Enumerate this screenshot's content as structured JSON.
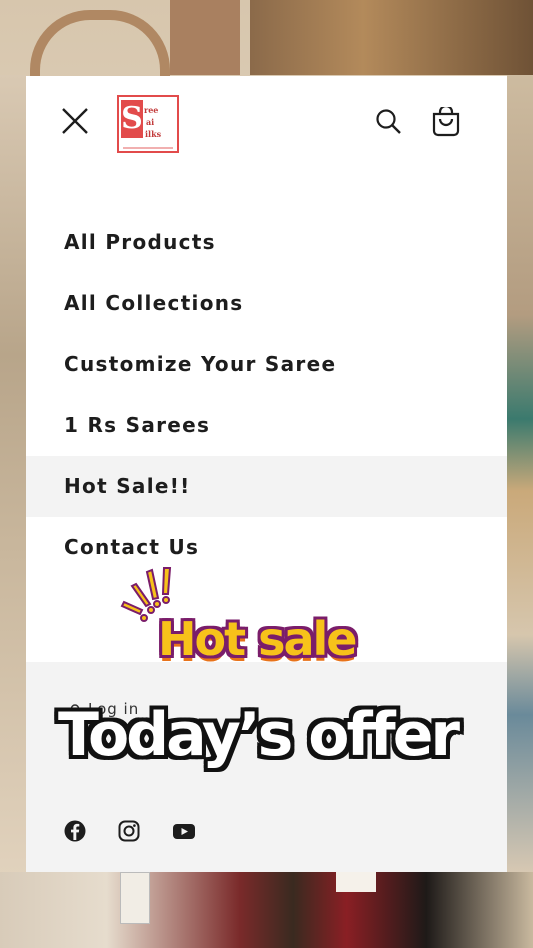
{
  "menu": {
    "logo_letters": [
      "S",
      "ree",
      "ai",
      "ilks"
    ],
    "items": [
      {
        "label": "All Products"
      },
      {
        "label": "All Collections"
      },
      {
        "label": "Customize Your Saree"
      },
      {
        "label": "1 Rs Sarees"
      },
      {
        "label": "Hot Sale!!",
        "active": true
      },
      {
        "label": "Contact Us"
      }
    ],
    "login_label": "Log in"
  },
  "icons": {
    "close": "close-icon",
    "search": "search-icon",
    "cart": "cart-icon",
    "user": "user-icon",
    "facebook": "facebook-icon",
    "instagram": "instagram-icon",
    "youtube": "youtube-icon"
  },
  "overlay": {
    "hot_sale": "Hot sale",
    "offer": "Today’s offer"
  },
  "colors": {
    "brand_red": "#e24b4b",
    "hot_sale_fill": "#f7c21a",
    "hot_sale_outline": "#7a1d6a"
  }
}
